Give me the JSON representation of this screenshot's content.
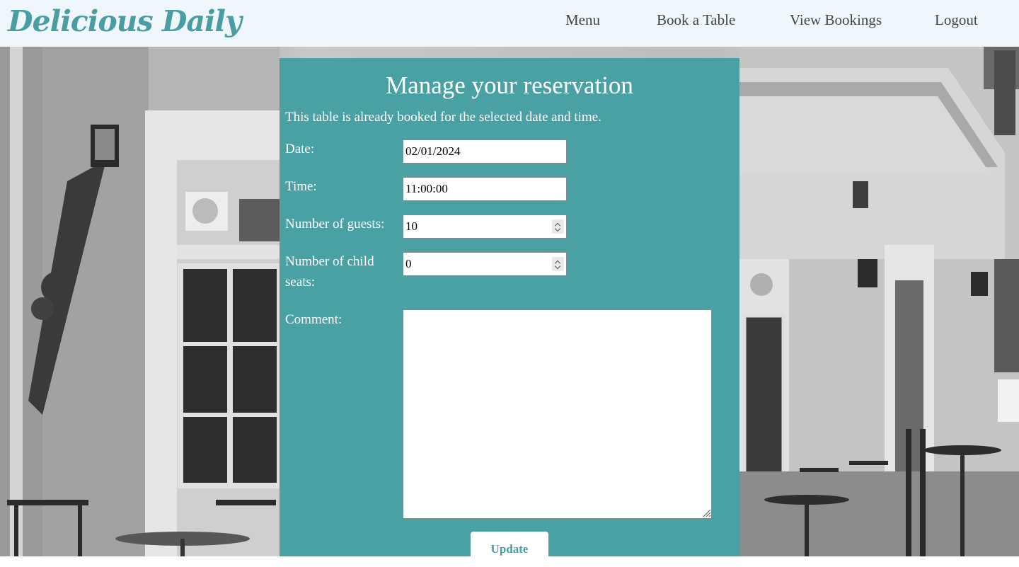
{
  "header": {
    "logo": "Delicious Daily",
    "nav": {
      "menu": "Menu",
      "book_table": "Book a Table",
      "view_bookings": "View Bookings",
      "logout": "Logout"
    }
  },
  "form": {
    "title": "Manage your reservation",
    "message": "This table is already booked for the selected date and time.",
    "date": {
      "label": "Date:",
      "value": "02/01/2024"
    },
    "time": {
      "label": "Time:",
      "value": "11:00:00"
    },
    "guests": {
      "label": "Number of guests:",
      "value": "10"
    },
    "child_seats": {
      "label": "Number of child seats:",
      "value": "0"
    },
    "comment": {
      "label": "Comment:",
      "value": ""
    },
    "submit_label": "Update"
  },
  "colors": {
    "accent": "#4aa1a4",
    "header_bg": "#f0f7fc",
    "logo": "#4a9ea3"
  },
  "icons": {
    "spinner": "spinner-arrows-icon",
    "resize": "resize-grip-icon"
  }
}
